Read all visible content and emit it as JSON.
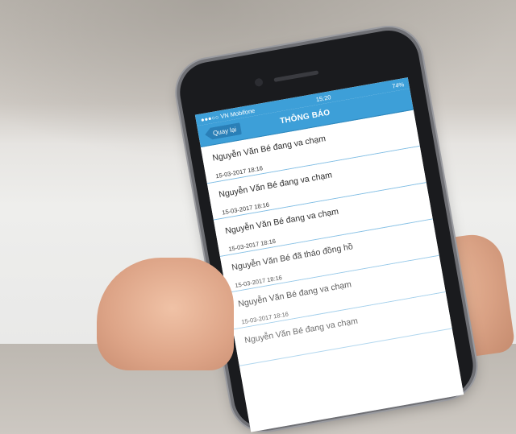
{
  "status": {
    "carrier": "●●●○○ VN Mobifone",
    "time": "15:20",
    "battery": "74%"
  },
  "nav": {
    "back_label": "Quay lại",
    "title": "THÔNG BÁO"
  },
  "notifications": [
    {
      "title": "Nguyễn Văn Bé đang va chạm",
      "time": "15-03-2017 18:16"
    },
    {
      "title": "Nguyễn Văn Bé đang va chạm",
      "time": "15-03-2017 18:16"
    },
    {
      "title": "Nguyễn Văn Bé đang va chạm",
      "time": "15-03-2017 18:16"
    },
    {
      "title": "Nguyễn Văn Bé đã tháo đồng hồ",
      "time": "15-03-2017 18:16"
    },
    {
      "title": "Nguyễn Văn Bé đang va chạm",
      "time": "15-03-2017 18:16"
    },
    {
      "title": "Nguyễn Văn Bé đang va chạm",
      "time": ""
    }
  ],
  "colors": {
    "accent": "#3d9fd8",
    "divider": "#7fbde4"
  }
}
